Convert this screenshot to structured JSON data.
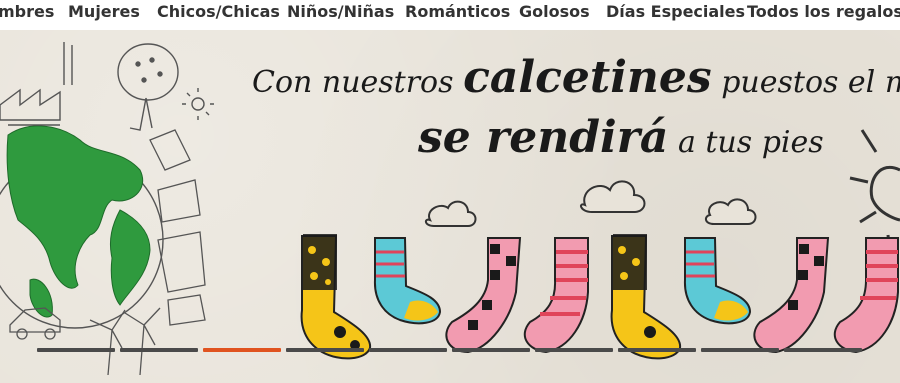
{
  "nav": {
    "items": [
      {
        "label": "mbres"
      },
      {
        "label": "Mujeres"
      },
      {
        "label": "Chicos/Chicas"
      },
      {
        "label": "Niños/Niñas"
      },
      {
        "label": "Románticos"
      },
      {
        "label": "Golosos"
      },
      {
        "label": "Días Especiales"
      },
      {
        "label": "Todos los regalos"
      }
    ]
  },
  "banner": {
    "line1_a": "Con nuestros ",
    "line1_b": "calcetines",
    "line1_c": " puestos el mu",
    "line2_a": "se rendirá",
    "line2_b": " a tus pies"
  },
  "slider": {
    "count": 10,
    "active_index": 2,
    "colors": {
      "inactive": "#4a4a4a",
      "active": "#e0531f"
    }
  },
  "colors": {
    "background": "#e8e3d9",
    "earth_green": "#2f9a3e",
    "sock_yellow": "#f5c518",
    "sock_pink": "#f29bb0",
    "sock_teal": "#5cc9d6",
    "sock_red": "#e0445a"
  }
}
